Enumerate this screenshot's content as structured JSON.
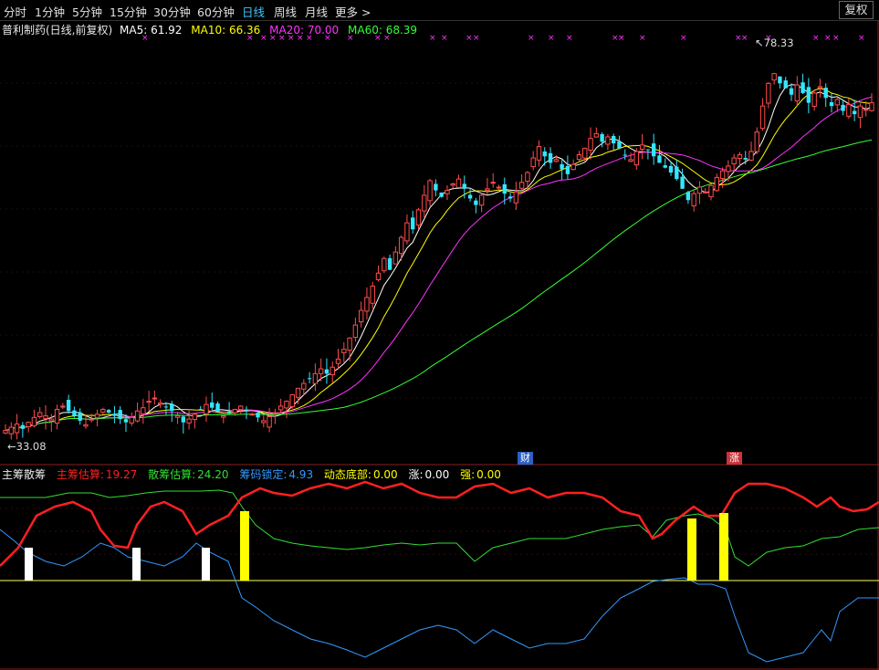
{
  "toolbar": {
    "periods": [
      "分时",
      "1分钟",
      "5分钟",
      "15分钟",
      "30分钟",
      "60分钟",
      "日线",
      "周线",
      "月线",
      "更多 >"
    ],
    "active_period": "日线",
    "fuquan_button": "复权"
  },
  "main_chart": {
    "stock_title": "普利制药(日线,前复权)",
    "ma_legend": [
      {
        "label": "MA5: 61.92",
        "color": "#ffffff"
      },
      {
        "label": "MA10: 66.36",
        "color": "#ffff00"
      },
      {
        "label": "MA20: 70.00",
        "color": "#ff33ff"
      },
      {
        "label": "MA60: 68.39",
        "color": "#33ff33"
      }
    ],
    "high_label": "78.33",
    "low_label": "33.08",
    "event_badges": [
      {
        "text": "财",
        "bg": "#2d5fc4",
        "fg": "#ffffff"
      },
      {
        "text": "涨",
        "bg": "#c8343a",
        "fg": "#ffffff"
      }
    ],
    "up_color": "#ff4c4c",
    "down_color": "#33e6ff"
  },
  "indicator": {
    "name": "主筹散筹",
    "items": [
      {
        "label": "主筹估算:",
        "value": "19.27",
        "color": "#ff2020"
      },
      {
        "label": "散筹估算:",
        "value": "24.20",
        "color": "#33dd33"
      },
      {
        "label": "筹码锁定:",
        "value": "4.93",
        "color": "#3399ff"
      },
      {
        "label": "动态底部:",
        "value": "0.00",
        "color": "#ffff00"
      },
      {
        "label": "涨:",
        "value": "0.00",
        "color": "#ffffff"
      },
      {
        "label": "强:",
        "value": "0.00",
        "color": "#ffff00"
      }
    ]
  },
  "chart_data": {
    "type": "candlestick",
    "title": "普利制药(日线,前复权)",
    "price_range": [
      33.08,
      78.33
    ],
    "price_extremes": {
      "high": 78.33,
      "low": 33.08
    },
    "ma_values": {
      "MA5": 61.92,
      "MA10": 66.36,
      "MA20": 70.0,
      "MA60": 68.39
    },
    "ma_colors": {
      "MA5": "#ffffff",
      "MA10": "#ffff00",
      "MA20": "#ff33ff",
      "MA60": "#33ff33"
    },
    "close_series": [
      33.2,
      33.6,
      34.0,
      33.4,
      34.2,
      34.8,
      35.4,
      35.0,
      34.6,
      35.8,
      36.2,
      35.6,
      35.0,
      34.4,
      33.9,
      34.6,
      35.2,
      35.8,
      35.4,
      35.0,
      34.6,
      34.2,
      34.8,
      35.6,
      36.0,
      36.8,
      37.2,
      36.6,
      36.1,
      35.6,
      35.0,
      34.2,
      34.6,
      35.2,
      35.8,
      36.4,
      36.0,
      35.5,
      35.0,
      35.4,
      35.8,
      36.2,
      35.7,
      35.2,
      34.8,
      34.4,
      34.9,
      35.4,
      36.2,
      36.8,
      37.6,
      38.4,
      39.0,
      39.6,
      40.2,
      40.8,
      40.2,
      41.0,
      42.0,
      43.2,
      44.6,
      46.2,
      48.0,
      49.6,
      51.0,
      52.6,
      54.4,
      53.0,
      55.2,
      57.0,
      58.8,
      58.0,
      60.4,
      62.2,
      64.0,
      62.8,
      62.0,
      62.8,
      63.6,
      64.2,
      63.0,
      61.8,
      61.0,
      62.2,
      63.0,
      63.8,
      63.2,
      62.4,
      61.8,
      62.6,
      63.8,
      65.0,
      66.8,
      68.2,
      67.0,
      66.2,
      66.6,
      65.4,
      64.8,
      66.0,
      67.2,
      68.0,
      69.2,
      69.8,
      68.8,
      69.4,
      68.6,
      68.0,
      67.2,
      66.6,
      67.6,
      68.4,
      67.8,
      67.0,
      66.2,
      65.6,
      65.0,
      64.2,
      63.0,
      61.6,
      62.4,
      63.2,
      62.6,
      63.4,
      64.4,
      65.2,
      65.8,
      66.8,
      67.2,
      66.6,
      67.6,
      70.0,
      73.2,
      76.0,
      77.2,
      76.0,
      75.4,
      74.6,
      75.8,
      74.8,
      73.6,
      74.8,
      75.6,
      74.2,
      73.2,
      74.0,
      72.6,
      73.4,
      72.2,
      73.2,
      72.8,
      73.6
    ],
    "indicator_series": {
      "主筹估算": 19.27,
      "散筹估算": 24.2,
      "筹码锁定": 4.93,
      "动态底部": 0.0,
      "涨": 0.0,
      "强": 0.0
    },
    "signal_bars": [
      {
        "color": "white"
      },
      {
        "color": "white"
      },
      {
        "color": "white"
      },
      {
        "color": "yellow"
      },
      {
        "color": "yellow"
      },
      {
        "color": "yellow"
      }
    ]
  }
}
